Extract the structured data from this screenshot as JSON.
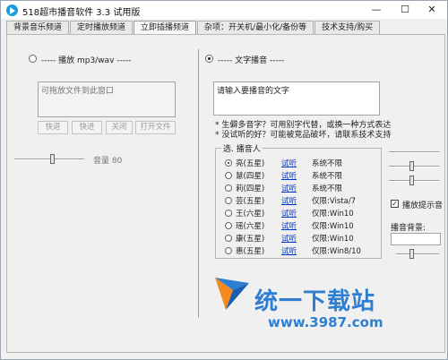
{
  "window": {
    "title": "518超市播音软件 3.3 试用版",
    "minimize": "—",
    "maximize": "☐",
    "close": "✕"
  },
  "tabs": [
    {
      "label": "背景音乐频道",
      "active": false
    },
    {
      "label": "定时播放频道",
      "active": false
    },
    {
      "label": "立即插播频道",
      "active": true
    },
    {
      "label": "杂项：开关机/最小化/备份等",
      "active": false
    },
    {
      "label": "技术支持/购买",
      "active": false
    }
  ],
  "left": {
    "mode_label": "----- 播放 mp3/wav -----",
    "mode_selected": false,
    "drop_placeholder": "可拖放文件到此窗口",
    "buttons": [
      "快退",
      "快进",
      "关闭",
      "打开文件"
    ],
    "volume_label": "音量 80",
    "volume_value": 80
  },
  "right": {
    "mode_label": "----- 文字播音 -----",
    "mode_selected": true,
    "text_placeholder": "请输入要播音的文字",
    "tips": [
      "* 生僻多音字？可用别字代替，或换一种方式表达",
      "* 没试听的好？可能被竞品破坏，请联系技术支持"
    ],
    "voice_group_title": "选. 播音人",
    "voices": [
      {
        "name": "亮(五星)",
        "listen": "试听",
        "sys": "系统不限",
        "selected": true
      },
      {
        "name": "慧(四星)",
        "listen": "试听",
        "sys": "系统不限",
        "selected": false
      },
      {
        "name": "莉(四星)",
        "listen": "试听",
        "sys": "系统不限",
        "selected": false
      },
      {
        "name": "芸(五星)",
        "listen": "试听",
        "sys": "仅限:Vista/7",
        "selected": false
      },
      {
        "name": "王(六星)",
        "listen": "试听",
        "sys": "仅限:Win10",
        "selected": false
      },
      {
        "name": "瑶(六星)",
        "listen": "试听",
        "sys": "仅限:Win10",
        "selected": false
      },
      {
        "name": "康(五星)",
        "listen": "试听",
        "sys": "仅限:Win10",
        "selected": false
      },
      {
        "name": "惠(五星)",
        "listen": "试听",
        "sys": "仅限:Win8/10",
        "selected": false
      }
    ],
    "play_tone_label": "播放提示音",
    "play_tone_checked": true,
    "background_label": "播音背景:"
  },
  "watermark": {
    "text": "统一下载站",
    "url": "www.3987.com"
  },
  "colors": {
    "accent": "#1a9ad9",
    "link": "#0033cc",
    "watermark": "#2e7fd1"
  }
}
